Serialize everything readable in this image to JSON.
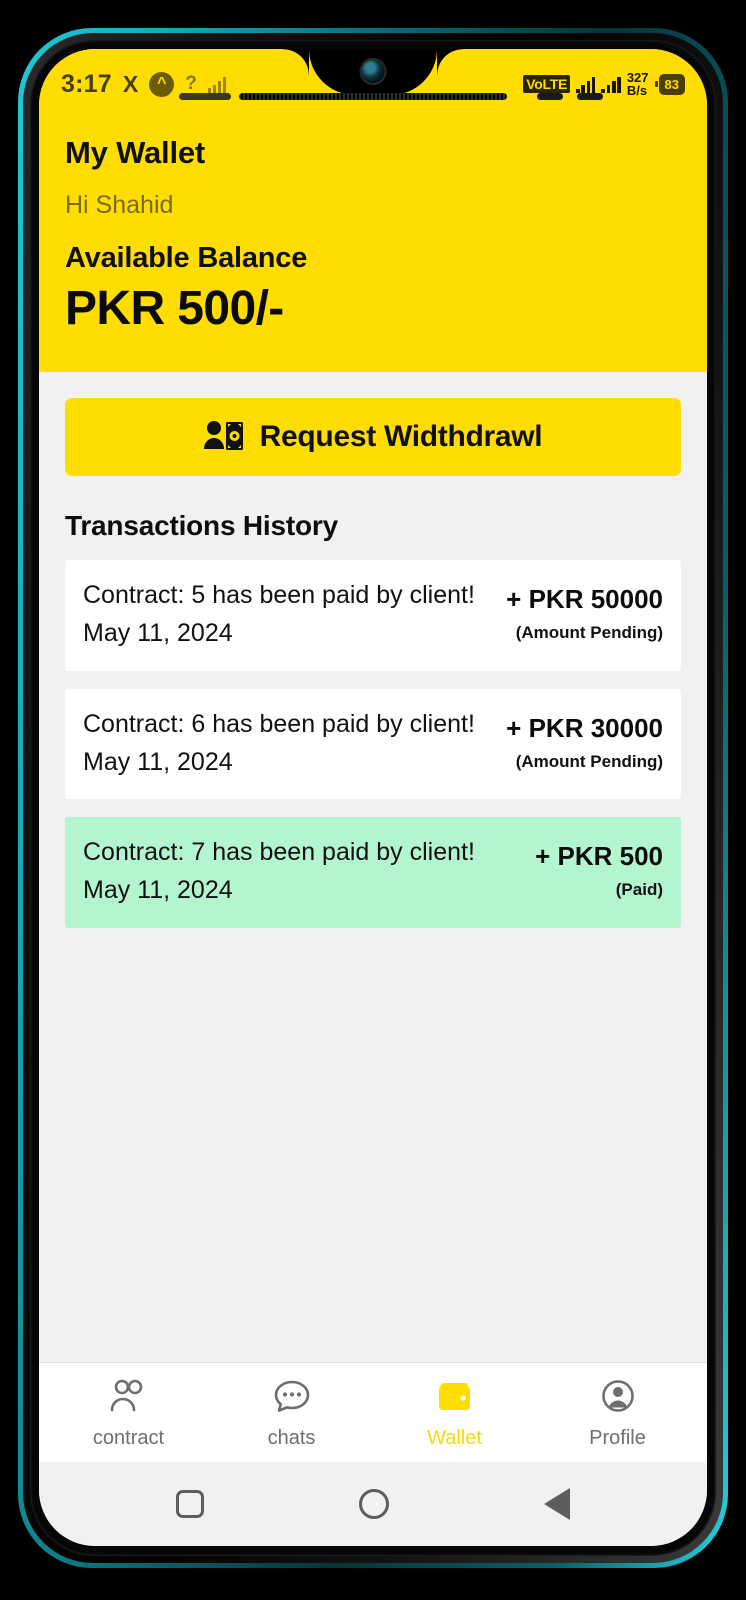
{
  "statusbar": {
    "time": "3:17",
    "x_icon": "X",
    "circle_icon": "^",
    "question_icon": "?",
    "volte": "VoLTE",
    "data_rate_value": "327",
    "data_rate_unit": "B/s",
    "battery": "83"
  },
  "header": {
    "title": "My Wallet",
    "greeting": "Hi Shahid",
    "balance_label": "Available Balance",
    "balance_amount": "PKR 500/-",
    "bg_color": "#FFDD00"
  },
  "withdraw": {
    "label": "Request Widthdrawl"
  },
  "transactions": {
    "section_title": "Transactions History",
    "items": [
      {
        "description": "Contract: 5 has been paid by client!",
        "date": "May 11, 2024",
        "amount": "+ PKR 50000",
        "status": "(Amount Pending)",
        "paid": false
      },
      {
        "description": "Contract: 6 has been paid by client!",
        "date": "May 11, 2024",
        "amount": "+ PKR 30000",
        "status": "(Amount Pending)",
        "paid": false
      },
      {
        "description": "Contract: 7 has been paid by client!",
        "date": "May 11, 2024",
        "amount": "+ PKR 500",
        "status": "(Paid)",
        "paid": true
      }
    ]
  },
  "bottom_nav": {
    "items": [
      {
        "label": "contract",
        "icon": "people-icon",
        "active": false
      },
      {
        "label": "chats",
        "icon": "chat-bubble-icon",
        "active": false
      },
      {
        "label": "Wallet",
        "icon": "wallet-icon",
        "active": true
      },
      {
        "label": "Profile",
        "icon": "person-circle-icon",
        "active": false
      }
    ],
    "active_color": "#F5D90A"
  },
  "android_nav": {
    "recents": "square",
    "home": "circle",
    "back": "triangle-left"
  },
  "colors": {
    "accent_yellow": "#FFDD00",
    "paid_green": "#B2F5CE",
    "body_gray": "#F1F1F1",
    "frame_teal": "#1fc9d4"
  }
}
